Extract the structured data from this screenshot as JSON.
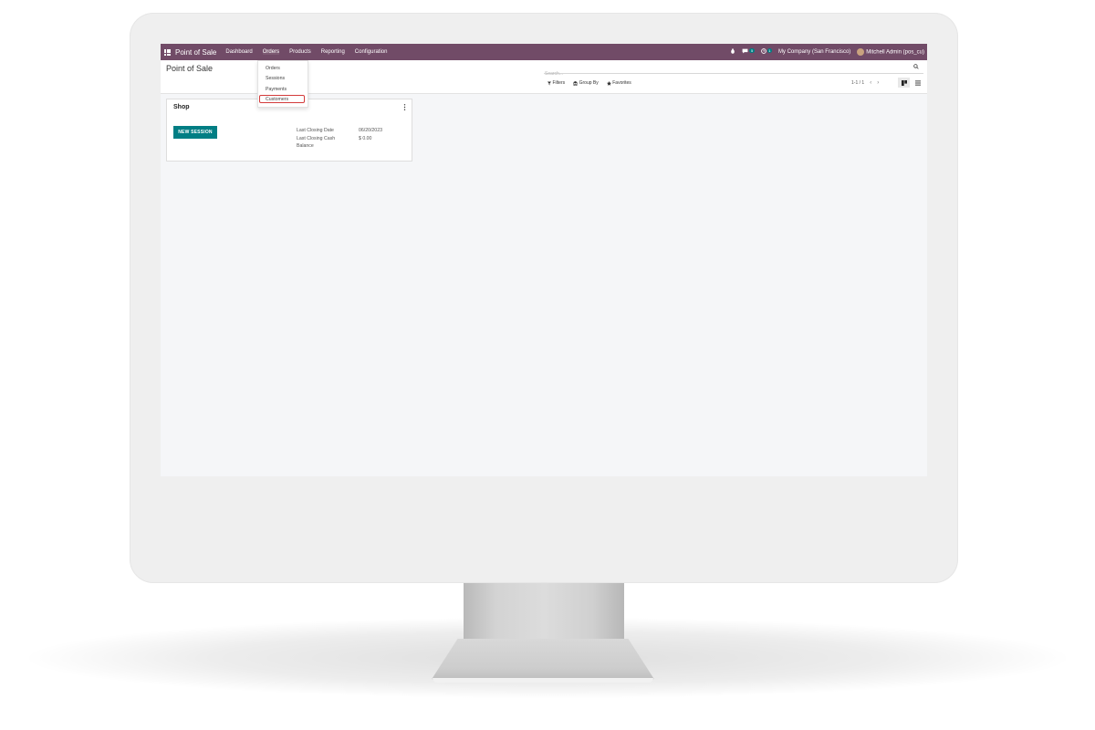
{
  "navbar": {
    "brand": "Point of Sale",
    "menu": [
      {
        "label": "Dashboard"
      },
      {
        "label": "Orders"
      },
      {
        "label": "Products"
      },
      {
        "label": "Reporting"
      },
      {
        "label": "Configuration"
      }
    ],
    "messages_badge": "5",
    "activities_badge": "1",
    "company": "My Company (San Francisco)",
    "user": "Mitchell Admin (pos_cu)"
  },
  "orders_dropdown": {
    "items": [
      {
        "label": "Orders"
      },
      {
        "label": "Sessions"
      },
      {
        "label": "Payments"
      },
      {
        "label": "Customers",
        "highlighted": true
      }
    ]
  },
  "control_panel": {
    "title": "Point of Sale",
    "search_placeholder": "Search...",
    "filters_label": "Filters",
    "group_by_label": "Group By",
    "favorites_label": "Favorites",
    "pager": "1-1 / 1",
    "views": [
      "kanban-view-icon",
      "list-view-icon"
    ]
  },
  "card": {
    "title": "Shop",
    "button_label": "NEW SESSION",
    "last_closing_date_label": "Last Closing Date",
    "last_closing_date_value": "06/20/2023",
    "last_closing_cash_label_1": "Last Closing Cash",
    "last_closing_cash_label_2": "Balance",
    "last_closing_cash_value": "$ 0.00"
  },
  "colors": {
    "navbar": "#714b67",
    "primary_button": "#017e84",
    "highlight_border": "#d33b3b"
  }
}
